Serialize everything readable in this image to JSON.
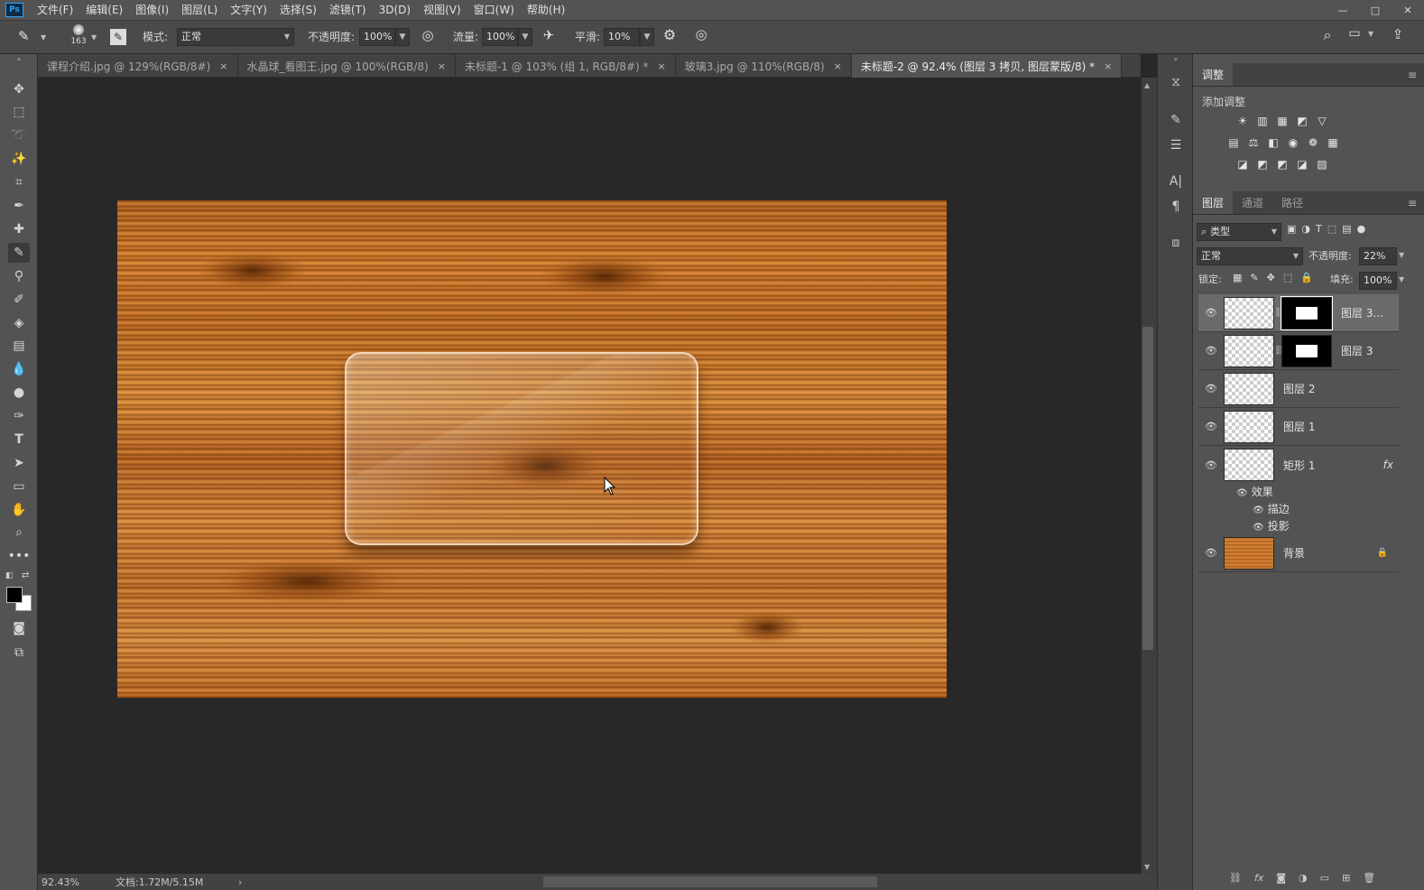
{
  "app": {
    "logo": "Ps"
  },
  "menu": [
    "文件(F)",
    "编辑(E)",
    "图像(I)",
    "图层(L)",
    "文字(Y)",
    "选择(S)",
    "滤镜(T)",
    "3D(D)",
    "视图(V)",
    "窗口(W)",
    "帮助(H)"
  ],
  "window_controls": {
    "minimize": "—",
    "maximize": "□",
    "close": "✕"
  },
  "options": {
    "brush_size": "163",
    "mode_label": "模式:",
    "mode_value": "正常",
    "opacity_label": "不透明度:",
    "opacity_value": "100%",
    "flow_label": "流量:",
    "flow_value": "100%",
    "smooth_label": "平滑:",
    "smooth_value": "10%"
  },
  "tabs": [
    {
      "label": "课程介绍.jpg @ 129%(RGB/8#)",
      "close": "×"
    },
    {
      "label": "水晶球_看图王.jpg @ 100%(RGB/8)",
      "close": "×"
    },
    {
      "label": "未标题-1 @ 103% (组 1, RGB/8#) *",
      "close": "×"
    },
    {
      "label": "玻璃3.jpg @ 110%(RGB/8)",
      "close": "×"
    },
    {
      "label": "未标题-2 @ 92.4% (图层 3 拷贝, 图层蒙版/8) *",
      "close": "×"
    }
  ],
  "status": {
    "zoom": "92.43%",
    "doc": "文档:1.72M/5.15M",
    "arrow": "›"
  },
  "adjust": {
    "tab": "调整",
    "title": "添加调整",
    "row1": [
      "☀",
      "▥",
      "▦",
      "◩",
      "▽"
    ],
    "row2": [
      "▤",
      "⚖",
      "◧",
      "◉",
      "❁",
      "▦"
    ],
    "row3": [
      "◪",
      "◩",
      "◩",
      "◪",
      "▨"
    ]
  },
  "layers_panel": {
    "tabs": [
      "图层",
      "通道",
      "路径"
    ],
    "filter_label": "类型",
    "blend": "正常",
    "opacity_label": "不透明度:",
    "opacity_value": "22%",
    "lock_label": "锁定:",
    "fill_label": "填充:",
    "fill_value": "100%"
  },
  "layers": [
    {
      "name": "图层 3..."
    },
    {
      "name": "图层 3"
    },
    {
      "name": "图层 2"
    },
    {
      "name": "图层 1"
    },
    {
      "name": "矩形 1",
      "fx": "fx"
    },
    {
      "name": "背景"
    }
  ],
  "effects": {
    "title": "效果",
    "items": [
      "描边",
      "投影"
    ]
  }
}
